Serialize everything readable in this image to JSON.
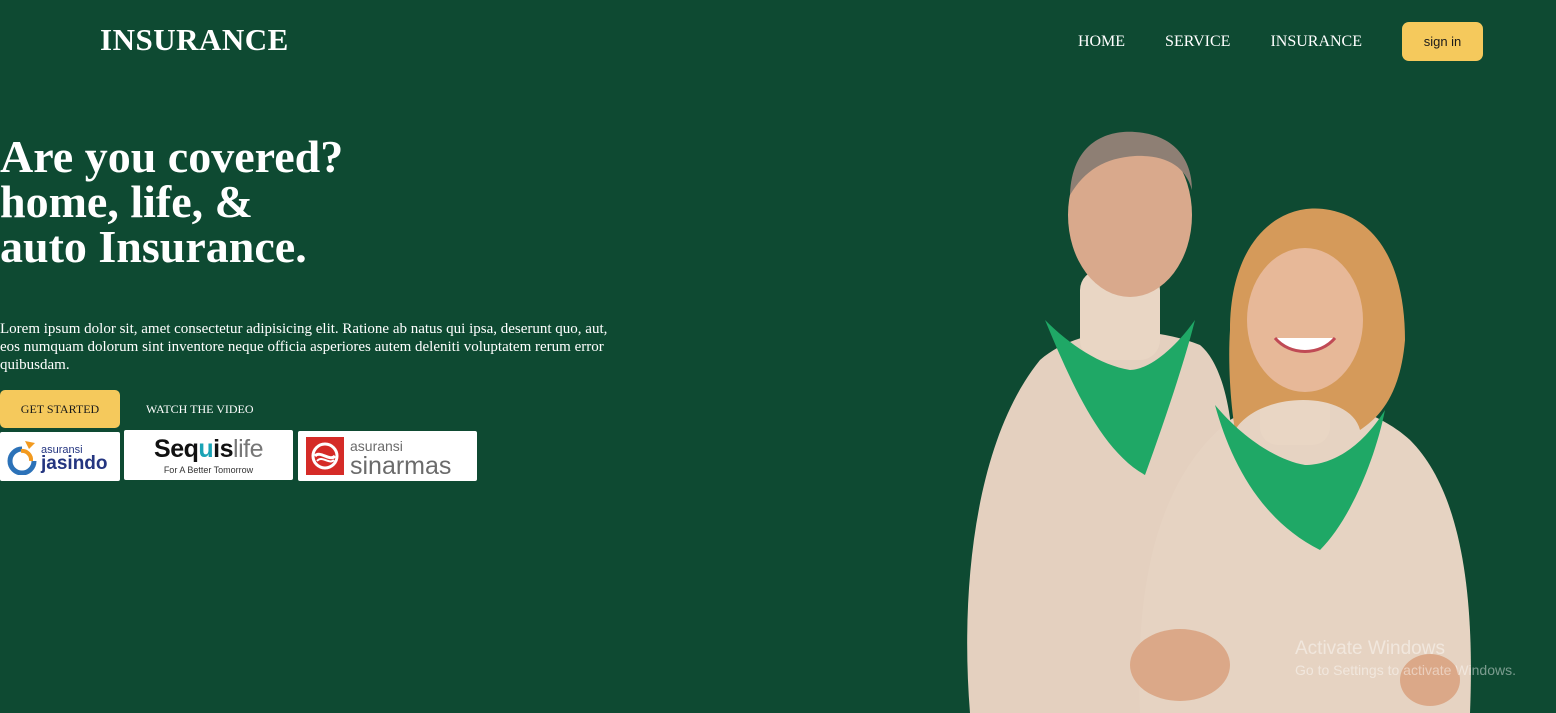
{
  "header": {
    "brand": "INSURANCE",
    "nav": [
      "HOME",
      "SERVICE",
      "INSURANCE"
    ],
    "signin_label": "sign in"
  },
  "hero": {
    "headline_lines": [
      "Are you covered?",
      "home, life, &",
      "auto Insurance."
    ],
    "description": "Lorem ipsum dolor sit, amet consectetur adipisicing elit. Ratione ab natus qui ipsa, deserunt quo, aut, eos numquam dolorum sint inventore neque officia asperiores autem deleniti voluptatem rerum error quibusdam.",
    "get_started_label": "GET STARTED",
    "watch_video_label": "WATCH THE VIDEO"
  },
  "partners": {
    "jasindo": {
      "small": "asuransi",
      "big": "jasindo"
    },
    "sequis": {
      "main_a": "Seq",
      "main_u": "u",
      "main_b": "is",
      "main_life": "life",
      "tagline": "For A Better Tomorrow"
    },
    "sinarmas": {
      "small": "asuransi",
      "big": "sinarmas"
    }
  },
  "watermark": {
    "title": "Activate Windows",
    "subtitle": "Go to Settings to activate Windows."
  },
  "colors": {
    "background": "#0e4a32",
    "accent": "#f5c95c",
    "scarf": "#1fa866",
    "sweater": "#e6d3c2"
  }
}
